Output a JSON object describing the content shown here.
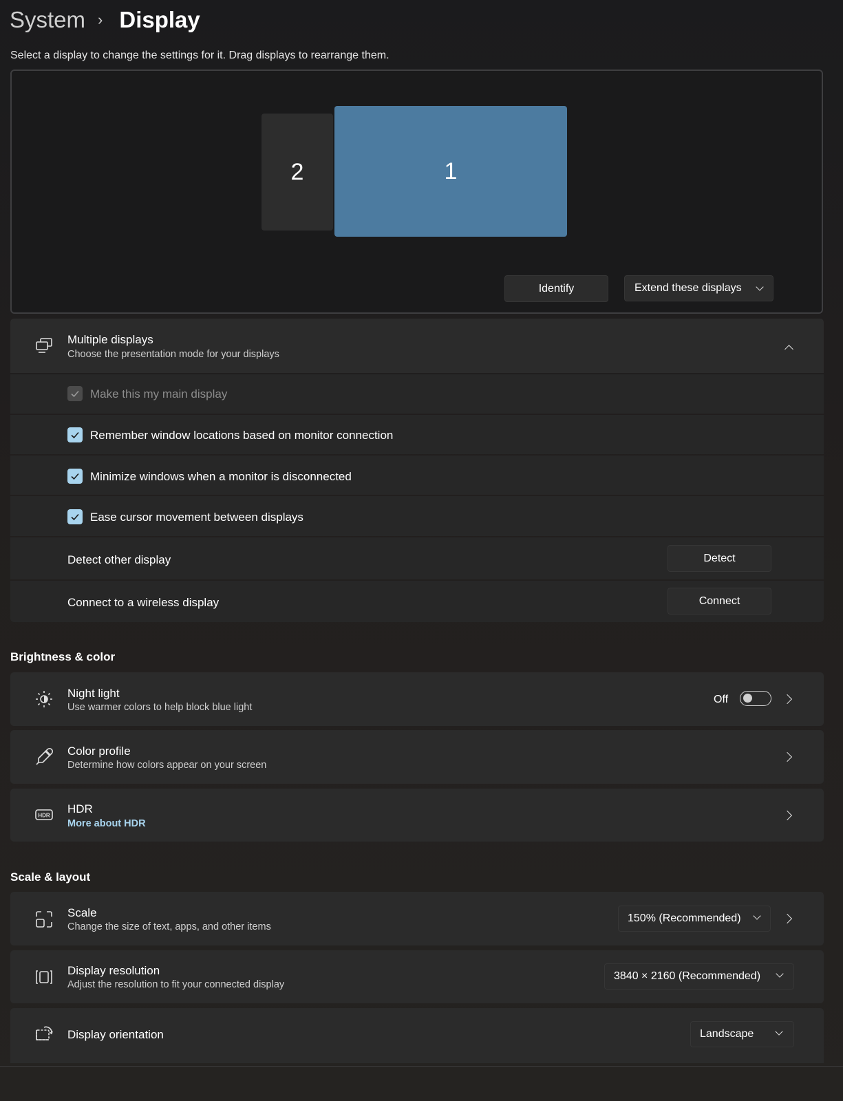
{
  "breadcrumb": {
    "parent": "System",
    "current": "Display"
  },
  "intro": "Select a display to change the settings for it. Drag displays to rearrange them.",
  "arrangement": {
    "monitors": [
      {
        "label": "2"
      },
      {
        "label": "1",
        "selected": true
      }
    ],
    "identify_label": "Identify",
    "mode_label": "Extend these displays"
  },
  "multiple_displays": {
    "title": "Multiple displays",
    "description": "Choose the presentation mode for your displays",
    "options": [
      {
        "label": "Make this my main display",
        "checked": true,
        "disabled": true
      },
      {
        "label": "Remember window locations based on monitor connection",
        "checked": true
      },
      {
        "label": "Minimize windows when a monitor is disconnected",
        "checked": true
      },
      {
        "label": "Ease cursor movement between displays",
        "checked": true
      }
    ],
    "detect": {
      "label": "Detect other display",
      "button": "Detect"
    },
    "connect": {
      "label": "Connect to a wireless display",
      "button": "Connect"
    }
  },
  "brightness_color": {
    "heading": "Brightness & color",
    "night_light": {
      "title": "Night light",
      "description": "Use warmer colors to help block blue light",
      "state": "Off"
    },
    "color_profile": {
      "title": "Color profile",
      "description": "Determine how colors appear on your screen"
    },
    "hdr": {
      "title": "HDR",
      "link": "More about HDR"
    }
  },
  "scale_layout": {
    "heading": "Scale & layout",
    "scale": {
      "title": "Scale",
      "description": "Change the size of text, apps, and other items",
      "value": "150% (Recommended)"
    },
    "resolution": {
      "title": "Display resolution",
      "description": "Adjust the resolution to fit your connected display",
      "value": "3840 × 2160 (Recommended)"
    },
    "orientation": {
      "title": "Display orientation",
      "value": "Landscape"
    }
  },
  "colors": {
    "accent": "#a8d4ee",
    "monitor_selected": "#4c7ba0",
    "card": "#2b2b2b"
  }
}
